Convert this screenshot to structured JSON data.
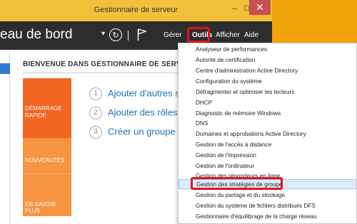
{
  "window": {
    "title": "Gestionnaire de serveur",
    "minimize_icon": "minimize-icon",
    "maximize_icon": "maximize-icon",
    "close_icon": "close-icon",
    "min_glyph": "‒",
    "max_glyph": "□",
    "close_glyph": "✕"
  },
  "header": {
    "breadcrumb": "eau de bord",
    "dropdown_glyph": "▾",
    "refresh_glyph": "↻",
    "menus": [
      "Gérer",
      "Outils",
      "Afficher",
      "Aide"
    ]
  },
  "main": {
    "welcome_title": "BIENVENUE DANS GESTIONNAIRE DE SERVEUR",
    "tiles": [
      "DÉMARRAGE RAPIDE",
      "NOUVEAUTÉS",
      "EN SAVOIR PLUS"
    ],
    "steps": [
      {
        "num": "1",
        "label": "Ajouter d'autres se"
      },
      {
        "num": "2",
        "label": "Ajouter des rôles e"
      },
      {
        "num": "3",
        "label": "Créer un groupe d"
      }
    ]
  },
  "tools_menu": {
    "items": [
      "Analyseur de performances",
      "Autorité de certification",
      "Centre d'administration Active Directory",
      "Configuration du système",
      "Défragmenter et optimiser les lecteurs",
      "DHCP",
      "Diagnostic de mémoire Windows",
      "DNS",
      "Domaines et approbations Active Directory",
      "Gestion de l'accès à distance",
      "Gestion de l'impression",
      "Gestion de l'ordinateur",
      "Gestion des répondeurs en ligne",
      "Gestion des stratégies de groupe",
      "Gestion du partage et du stockage",
      "Gestion du système de fichiers distribués DFS",
      "Gestionnaire d'équilibrage de la charge réseau"
    ],
    "selected_index": 13
  },
  "colors": {
    "titlebar": "#f2c03a",
    "header": "#2d2d2d",
    "accent_orange": "#f26522",
    "tile_orange": "#f79443",
    "highlight_red": "#e0141e",
    "menu_selected": "#dcebfb",
    "desktop": "#f0a30a"
  }
}
